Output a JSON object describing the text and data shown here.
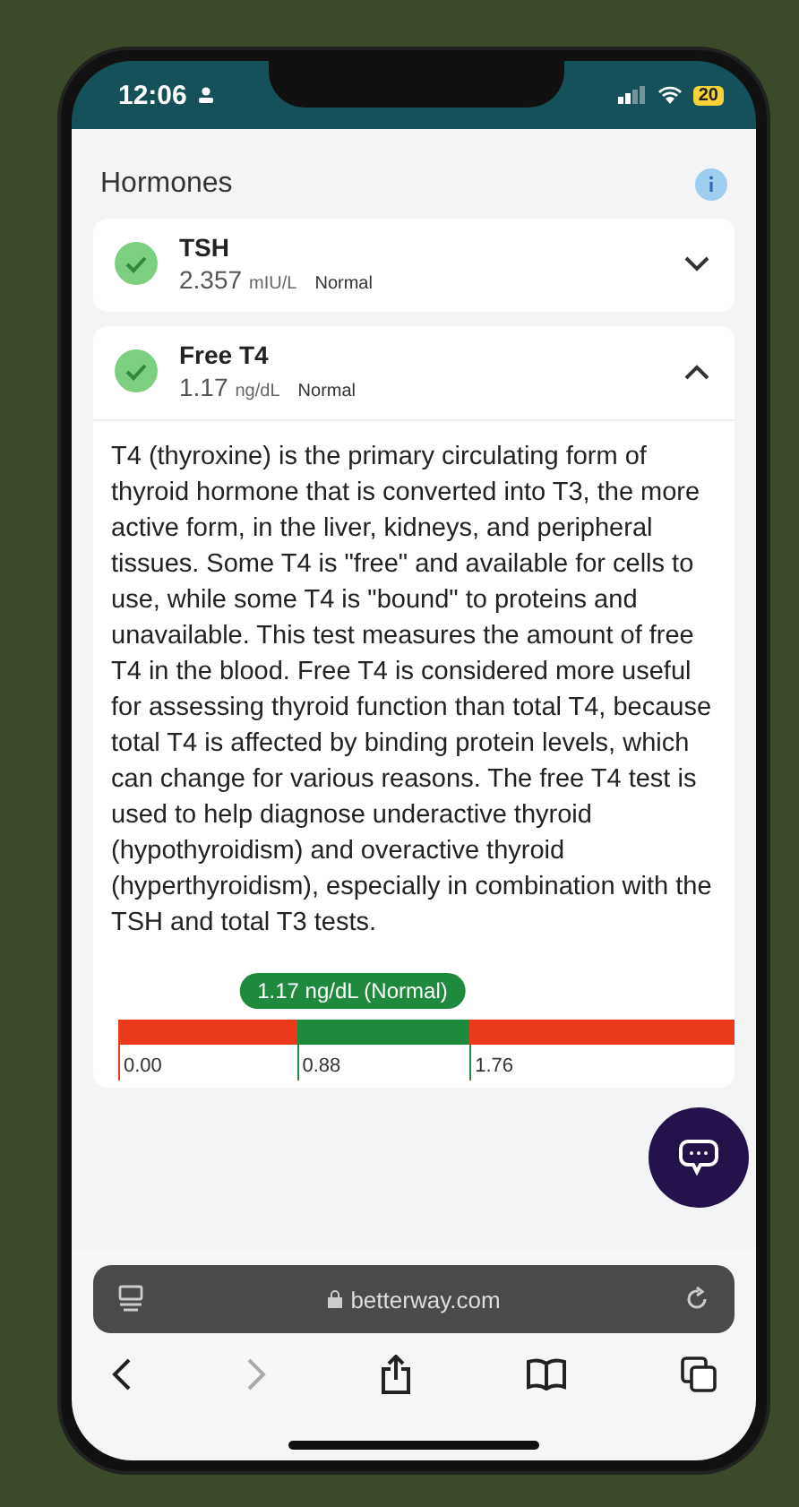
{
  "status_bar": {
    "time": "12:06",
    "battery": "20"
  },
  "section": {
    "title": "Hormones"
  },
  "tests": [
    {
      "name": "TSH",
      "value": "2.357",
      "unit": "mIU/L",
      "status": "Normal",
      "expanded": false
    },
    {
      "name": "Free T4",
      "value": "1.17",
      "unit": "ng/dL",
      "status": "Normal",
      "expanded": true,
      "description": "T4 (thyroxine) is the primary circulating form of thyroid hormone that is converted into T3, the more active form, in the liver, kidneys, and peripheral tissues. Some T4 is \"free\" and available for cells to use, while some T4 is \"bound\" to proteins and unavailable. This test measures the amount of free T4 in the blood. Free T4 is considered more useful for assessing thyroid function than total T4, because total T4 is affected by binding protein levels, which can change for various reasons. The free T4 test is used to help diagnose underactive thyroid (hypothyroidism) and overactive thyroid (hyperthyroidism), especially in combination with the TSH and total T3 tests.",
      "range": {
        "marker_label": "1.17 ng/dL (Normal)",
        "level": 0.38,
        "ticks": [
          {
            "label": "0.00",
            "level": 0
          },
          {
            "label": "0.88",
            "level": 0.29
          },
          {
            "label": "1.76",
            "level": 0.57
          }
        ]
      }
    }
  ],
  "browser": {
    "address": "betterway.com"
  }
}
